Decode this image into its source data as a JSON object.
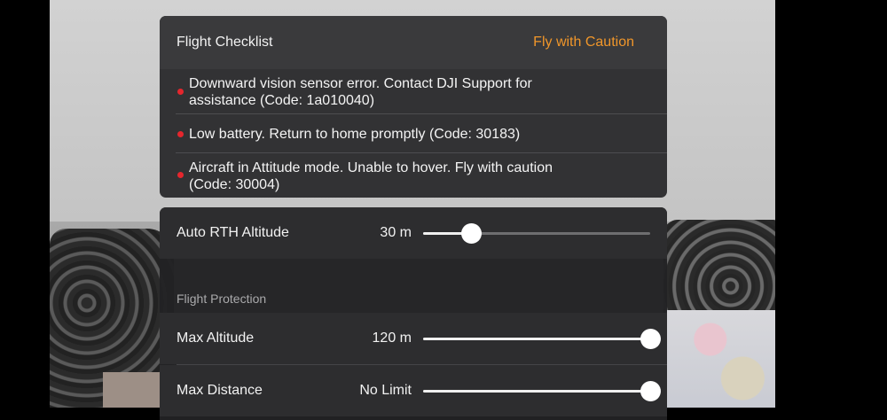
{
  "checklist": {
    "title": "Flight Checklist",
    "status": "Fly with Caution",
    "status_color": "#f0962a",
    "warnings": [
      {
        "text": "Downward vision sensor error. Contact DJI Support for assistance (Code: 1a010040)"
      },
      {
        "text": "Low battery. Return to home promptly (Code: 30183)"
      },
      {
        "text": "Aircraft in Attitude mode. Unable to hover. Fly with caution (Code: 30004)"
      }
    ],
    "warning_dot_color": "#e5262d"
  },
  "settings": {
    "auto_rth": {
      "label": "Auto RTH Altitude",
      "value": "30 m",
      "slider_level": 0.21
    },
    "section_label": "Flight Protection",
    "max_altitude": {
      "label": "Max Altitude",
      "value": "120 m",
      "slider_level": 1.0
    },
    "max_distance": {
      "label": "Max Distance",
      "value": "No Limit",
      "slider_level": 1.0
    }
  }
}
